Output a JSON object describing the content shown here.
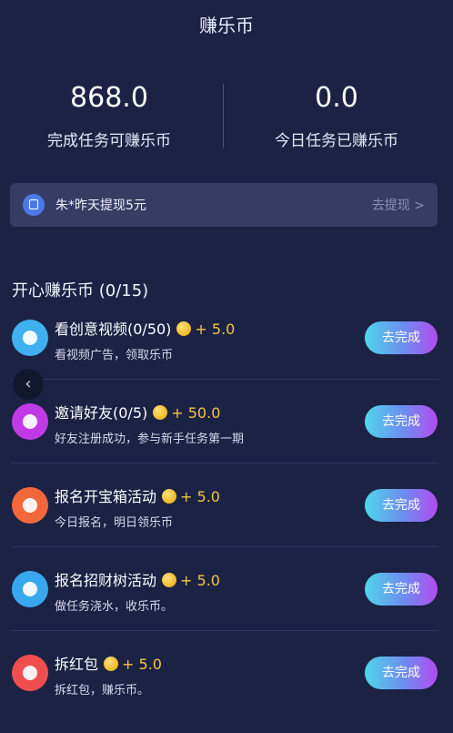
{
  "header": {
    "title": "赚乐币"
  },
  "stats": [
    {
      "value": "868.0",
      "label": "完成任务可赚乐币"
    },
    {
      "value": "0.0",
      "label": "今日任务已赚乐币"
    }
  ],
  "banner": {
    "icon": "wallet-icon",
    "text": "朱*昨天提现5元",
    "link": "去提现 >"
  },
  "section": {
    "title": "开心赚乐币 (0/15)"
  },
  "tasks": [
    {
      "title": "看创意视频(0/50)",
      "reward": "+ 5.0",
      "desc": "看视频广告，领取乐币",
      "button": "去完成",
      "icon": "chat-bubble-icon",
      "icon_color": "#3fb0f0"
    },
    {
      "title": "邀请好友(0/5)",
      "reward": "+ 50.0",
      "desc": "好友注册成功，参与新手任务第一期",
      "button": "去完成",
      "icon": "user-icon",
      "icon_color": "#c03be6"
    },
    {
      "title": "报名开宝箱活动",
      "reward": "+ 5.0",
      "desc": "今日报名，明日领乐币",
      "button": "去完成",
      "icon": "treasure-box-icon",
      "icon_color": "#f2683a"
    },
    {
      "title": "报名招财树活动",
      "reward": "+ 5.0",
      "desc": "做任务浇水，收乐币。",
      "button": "去完成",
      "icon": "tree-icon",
      "icon_color": "#38a8ee"
    },
    {
      "title": "拆红包",
      "reward": "+ 5.0",
      "desc": "拆红包，赚乐币。",
      "button": "去完成",
      "icon": "red-envelope-icon",
      "icon_color": "#f04e4e"
    }
  ],
  "side_nav": {
    "arrow": "‹"
  }
}
